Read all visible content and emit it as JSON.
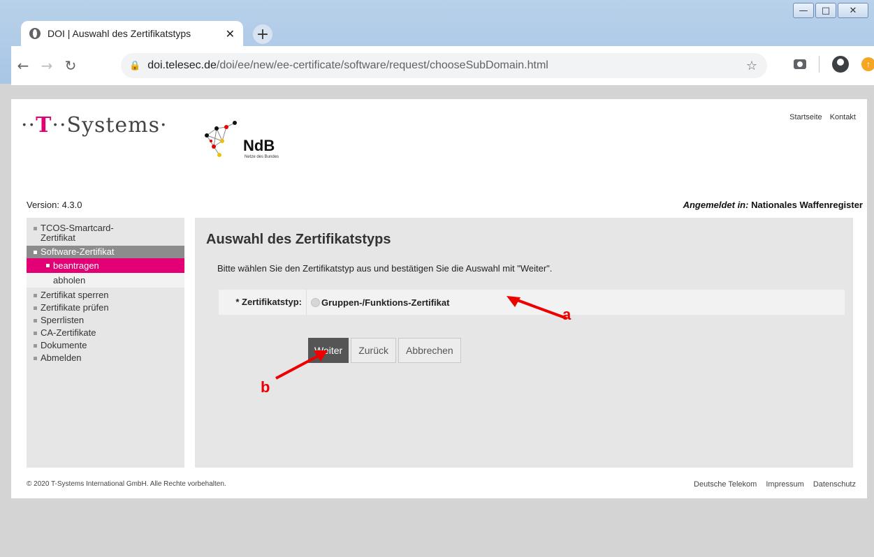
{
  "browser": {
    "tab_title": "DOI | Auswahl des Zertifikatstyps",
    "url_host": "doi.telesec.de",
    "url_path": "/doi/ee/new/ee-certificate/software/request/chooseSubDomain.html",
    "new_tab_symbol": "+",
    "close_symbol": "✕",
    "ext_badge": "↑"
  },
  "header": {
    "logo_text_pre": "··",
    "logo_t": "T",
    "logo_text_post": "··Systems·",
    "ndb_title": "NdB",
    "ndb_subtitle": "Netze des Bundes",
    "links": [
      "Startseite",
      "Kontakt"
    ],
    "version": "Version: 4.3.0",
    "login_label": "Angemeldet in:",
    "login_value": "Nationales Waffenregister"
  },
  "sidebar": {
    "items": [
      {
        "label": "TCOS-Smartcard-Zertifikat"
      },
      {
        "label": "Software-Zertifikat"
      },
      {
        "label": "beantragen"
      },
      {
        "label": "abholen"
      },
      {
        "label": "Zertifikat sperren"
      },
      {
        "label": "Zertifikate prüfen"
      },
      {
        "label": "Sperrlisten"
      },
      {
        "label": "CA-Zertifikate"
      },
      {
        "label": "Dokumente"
      },
      {
        "label": "Abmelden"
      }
    ]
  },
  "main": {
    "title": "Auswahl des Zertifikatstyps",
    "intro": "Bitte wählen Sie den Zertifikatstyp aus und bestätigen Sie die Auswahl mit \"Weiter\".",
    "field_label": "* Zertifikatstyp:",
    "option_label": "Gruppen-/Funktions-Zertifikat",
    "buttons": {
      "next": "Weiter",
      "back": "Zurück",
      "cancel": "Abbrechen"
    }
  },
  "annotations": {
    "a": "a",
    "b": "b",
    "color": "#e00000"
  },
  "footer": {
    "copyright": "© 2020 T-Systems International GmbH. Alle Rechte vorbehalten.",
    "links": [
      "Deutsche Telekom",
      "Impressum",
      "Datenschutz"
    ]
  },
  "colors": {
    "brand_magenta": "#e20074",
    "nav_active": "#8c8c8c",
    "button_primary": "#555555"
  }
}
